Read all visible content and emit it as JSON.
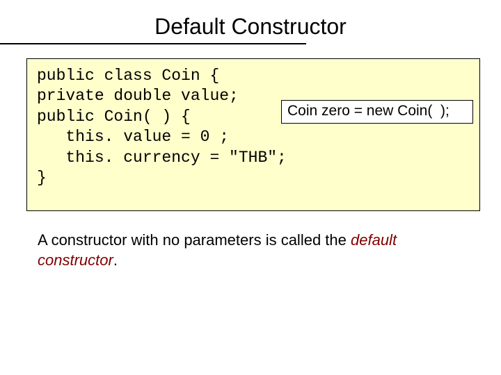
{
  "title": "Default Constructor",
  "code": {
    "line1": "public class Coin {",
    "line2": "private double value;",
    "line3": "public Coin( ) {",
    "line4": "   this. value = 0 ;",
    "line5": "   this. currency = \"THB\";",
    "line6": "}"
  },
  "callout": "Coin zero = new Coin(  );",
  "paragraph": {
    "part1": "A constructor with no parameters is called the ",
    "em": "default constructor",
    "part2": "."
  }
}
